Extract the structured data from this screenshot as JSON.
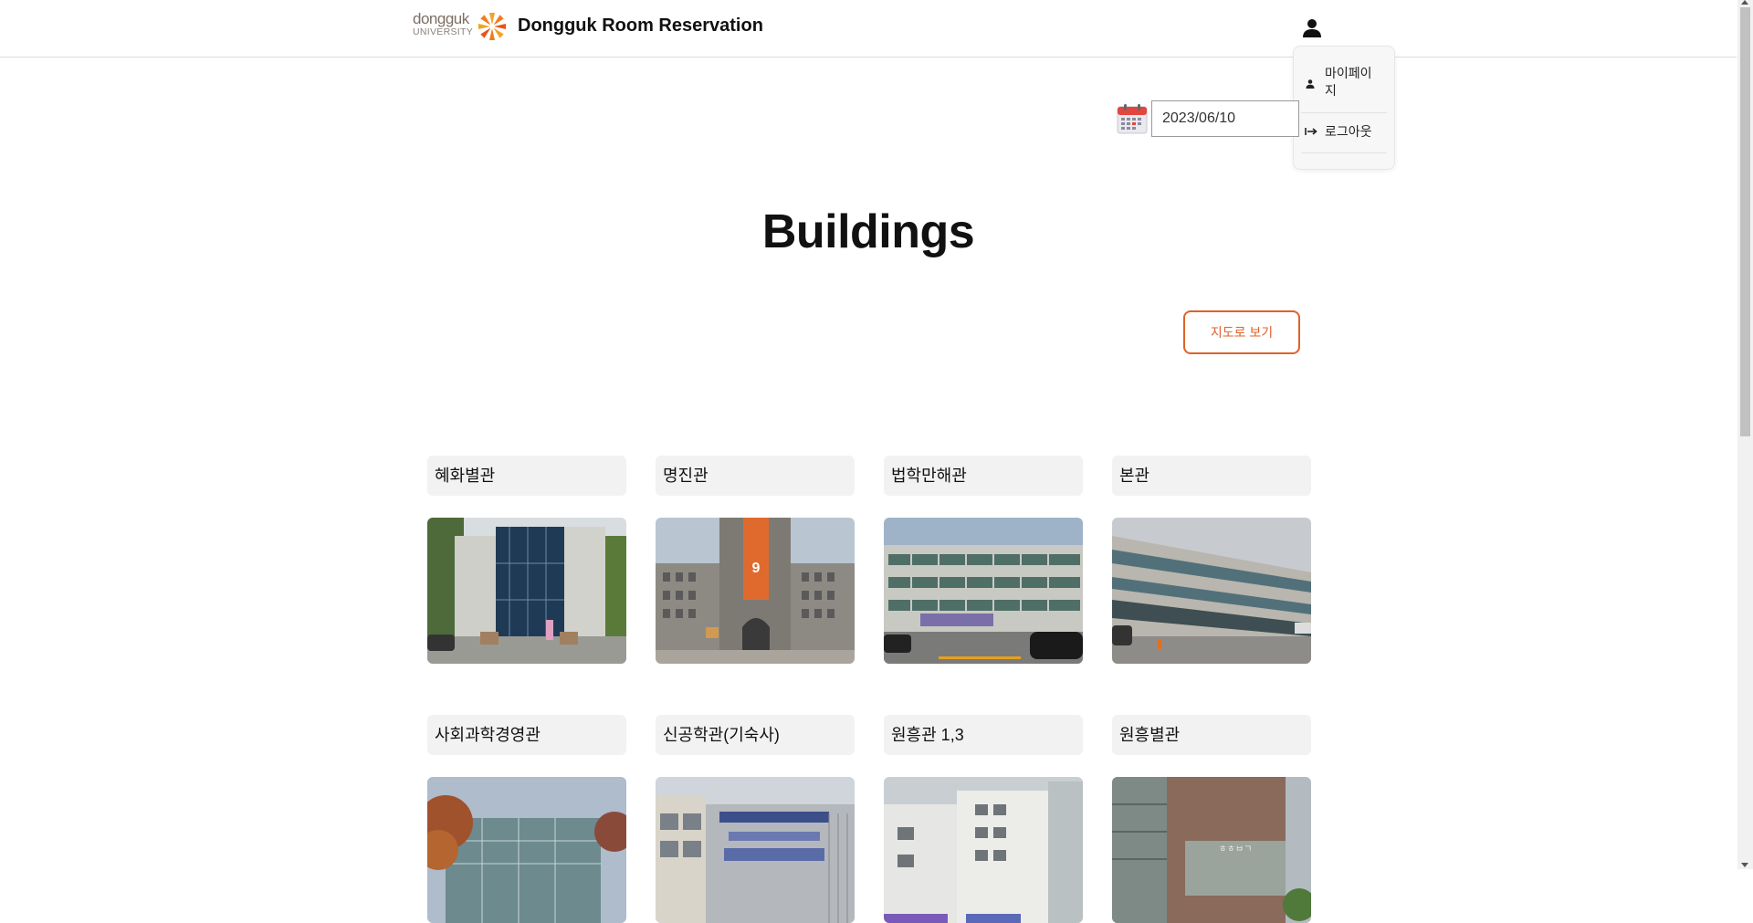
{
  "header": {
    "logo": {
      "line1": "dongguk",
      "line2": "UNIVERSITY"
    },
    "title": "Dongguk Room Reservation",
    "user_icon": "user-icon"
  },
  "user_menu": {
    "items": [
      {
        "label": "마이페이지",
        "icon": "person-icon"
      },
      {
        "label": "로그아웃",
        "icon": "logout-icon"
      }
    ]
  },
  "date_picker": {
    "icon": "calendar-icon",
    "value": "2023/06/10"
  },
  "page": {
    "title": "Buildings",
    "map_button": "지도로 보기"
  },
  "buildings": [
    {
      "name": "혜화별관"
    },
    {
      "name": "명진관"
    },
    {
      "name": "법학만해관"
    },
    {
      "name": "본관"
    },
    {
      "name": "사회과학경영관"
    },
    {
      "name": "신공학관(기숙사)"
    },
    {
      "name": "원흥관 1,3"
    },
    {
      "name": "원흥별관"
    }
  ],
  "colors": {
    "accent": "#e0622a",
    "label_bg": "#f2f2f2"
  }
}
